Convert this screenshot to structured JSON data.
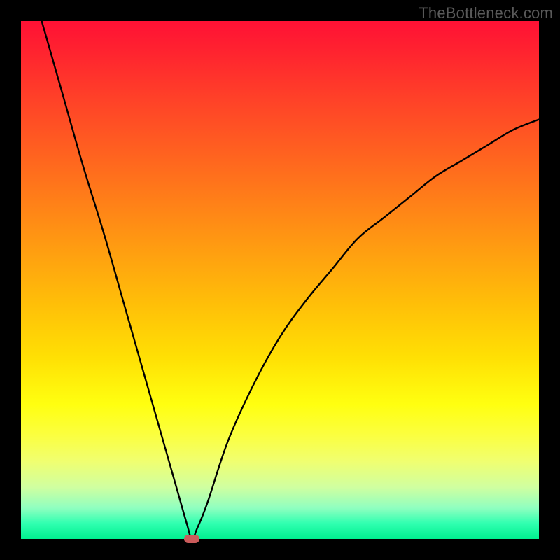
{
  "watermark": "TheBottleneck.com",
  "colors": {
    "top": "#ff1135",
    "mid": "#ffe000",
    "bottom": "#00f090",
    "curve": "#000000",
    "marker": "#cb5b5b",
    "frame": "#000000"
  },
  "chart_data": {
    "type": "line",
    "title": "",
    "xlabel": "",
    "ylabel": "",
    "xlim": [
      0,
      100
    ],
    "ylim": [
      0,
      100
    ],
    "grid": false,
    "series": [
      {
        "name": "bottleneck-curve",
        "x": [
          4,
          8,
          12,
          16,
          20,
          24,
          28,
          30,
          32,
          33,
          34,
          36,
          40,
          45,
          50,
          55,
          60,
          65,
          70,
          75,
          80,
          85,
          90,
          95,
          100
        ],
        "y": [
          100,
          86,
          72,
          59,
          45,
          31,
          17,
          10,
          3,
          0,
          2,
          7,
          19,
          30,
          39,
          46,
          52,
          58,
          62,
          66,
          70,
          73,
          76,
          79,
          81
        ]
      }
    ],
    "annotations": [
      {
        "type": "marker",
        "x": 33,
        "y": 0,
        "shape": "rounded-rect",
        "color": "#cb5b5b"
      }
    ],
    "legend": false,
    "background_gradient": {
      "direction": "vertical",
      "stops": [
        {
          "pos": 0.0,
          "color": "#ff1135"
        },
        {
          "pos": 0.4,
          "color": "#ff8018"
        },
        {
          "pos": 0.74,
          "color": "#ffff10"
        },
        {
          "pos": 1.0,
          "color": "#00f090"
        }
      ]
    }
  }
}
